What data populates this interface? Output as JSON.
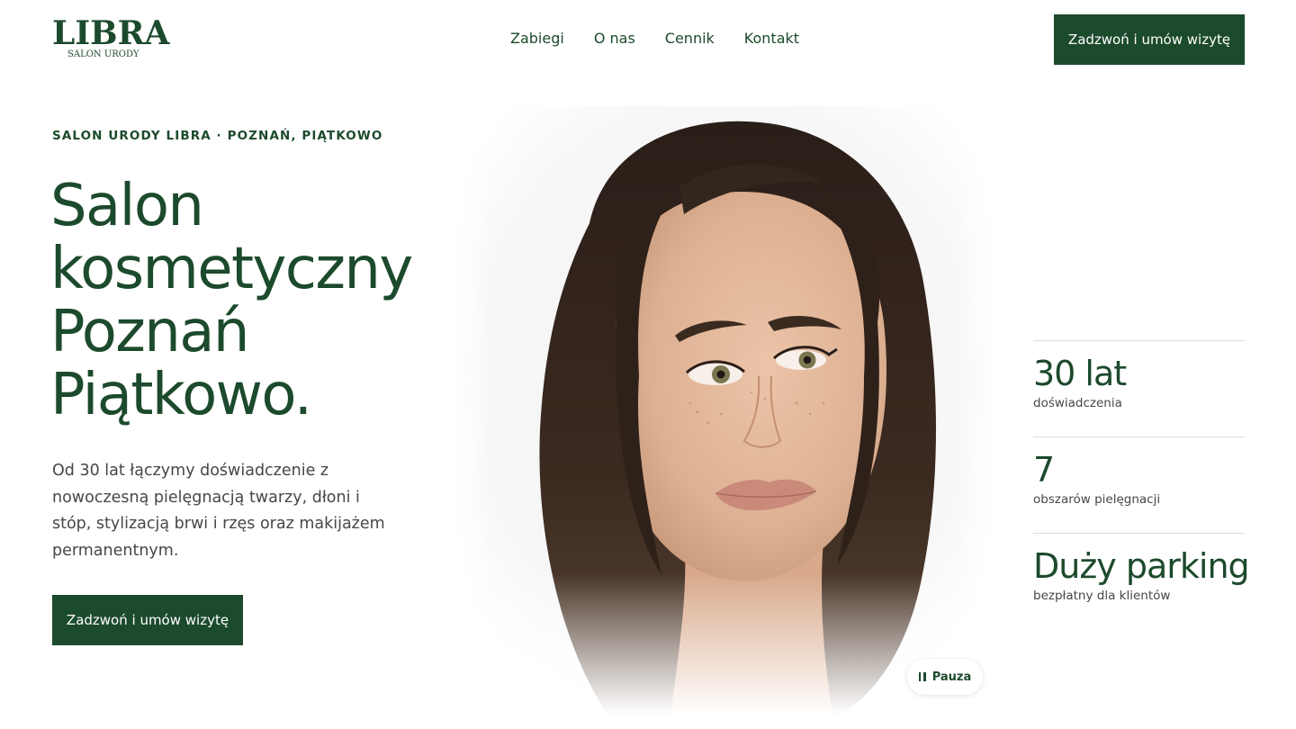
{
  "brand": {
    "name": "LIBRA",
    "tagline": "SALON URODY"
  },
  "nav": {
    "items": [
      {
        "label": "Zabiegi"
      },
      {
        "label": "O nas"
      },
      {
        "label": "Cennik"
      },
      {
        "label": "Kontakt"
      }
    ]
  },
  "header": {
    "cta_label": "Zadzwoń i umów wizytę"
  },
  "hero": {
    "eyebrow": "SALON URODY LIBRA · POZNAŃ, PIĄTKOWO",
    "title_lines": [
      "Salon",
      "kosmetyczny",
      "Poznań",
      "Piątkowo."
    ],
    "description": "Od 30 lat łączymy doświadczenie z nowoczesną pielęgnacją twarzy, dłoni i stóp, stylizacją brwi i rzęs oraz makijażem permanentnym.",
    "cta_label": "Zadzwoń i umów wizytę"
  },
  "media": {
    "pause_label": "Pauza"
  },
  "stats": [
    {
      "value": "30 lat",
      "label": "doświadczenia"
    },
    {
      "value": "7",
      "label": "obszarów pielęgnacji"
    },
    {
      "value": "Duży parking",
      "label": "bezpłatny dla klientów"
    }
  ],
  "colors": {
    "brand_green": "#1c4a2c",
    "text_gray": "#474747",
    "divider": "#dcdcdc",
    "background": "#ffffff"
  }
}
